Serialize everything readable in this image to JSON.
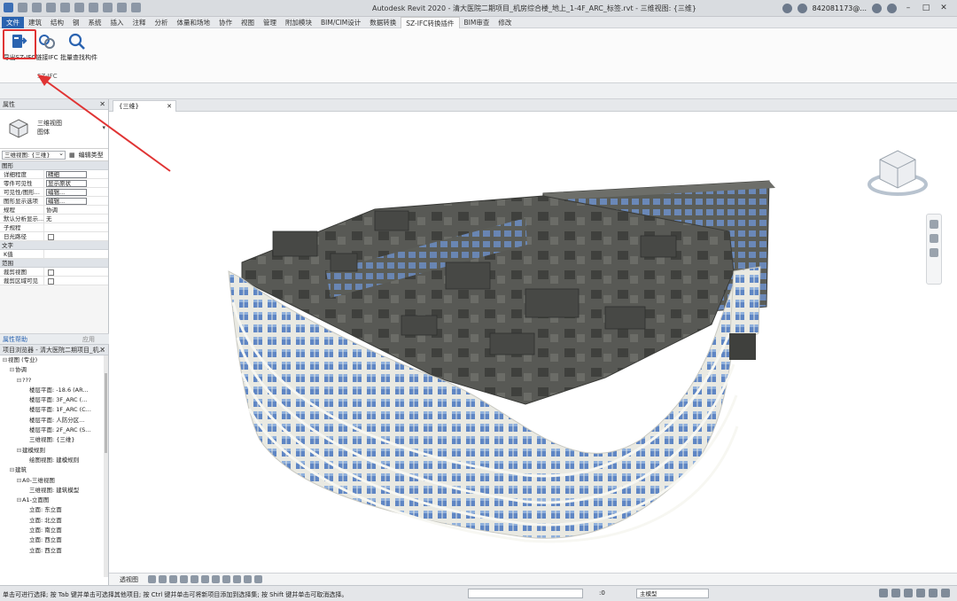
{
  "title_bar": {
    "title": "Autodesk Revit 2020 - 清大医院二期项目_机房综合楼_地上_1-4F_ARC_标签.rvt - 三维视图: {三维}",
    "user": "842081173@...",
    "minimize": "–",
    "maximize": "□",
    "close": "✕"
  },
  "ribbon_tabs": [
    {
      "label": "文件"
    },
    {
      "label": "建筑"
    },
    {
      "label": "结构"
    },
    {
      "label": "钢"
    },
    {
      "label": "系统"
    },
    {
      "label": "插入"
    },
    {
      "label": "注释"
    },
    {
      "label": "分析"
    },
    {
      "label": "体量和场地"
    },
    {
      "label": "协作"
    },
    {
      "label": "视图"
    },
    {
      "label": "管理"
    },
    {
      "label": "附加模块"
    },
    {
      "label": "BIM/CIM设计"
    },
    {
      "label": "数据转换"
    },
    {
      "label": "SZ-IFC转换插件"
    },
    {
      "label": "BIM审查"
    },
    {
      "label": "修改"
    }
  ],
  "ribbon": {
    "buttons": [
      {
        "label": "导出SZ-IFC"
      },
      {
        "label": "链接IFC"
      },
      {
        "label": "批量查找构件"
      }
    ],
    "panel_label": "SZ-IFC"
  },
  "properties": {
    "title": "属性",
    "close": "✕",
    "type_name_1": "三维视图",
    "type_name_2": "图体",
    "filter_value": "三维视图: {三维}",
    "edit_type": "编辑类型",
    "groups": [
      {
        "name": "图形",
        "rows": [
          {
            "k": "详细程度",
            "v": "精细",
            "kind": "box"
          },
          {
            "k": "零件可见性",
            "v": "显示原状",
            "kind": "box"
          },
          {
            "k": "可见性/图形...",
            "v": "编辑...",
            "kind": "btn"
          },
          {
            "k": "图形显示选项",
            "v": "编辑...",
            "kind": "btn"
          },
          {
            "k": "规程",
            "v": "协调",
            "kind": "text"
          },
          {
            "k": "默认分析显示...",
            "v": "无",
            "kind": "text"
          },
          {
            "k": "子规程",
            "v": "",
            "kind": "text"
          },
          {
            "k": "日光路径",
            "v": "",
            "kind": "chk"
          }
        ]
      },
      {
        "name": "文字",
        "rows": [
          {
            "k": "K值",
            "v": "",
            "kind": "text"
          }
        ]
      },
      {
        "name": "范围",
        "rows": [
          {
            "k": "裁剪视图",
            "v": "",
            "kind": "chk"
          },
          {
            "k": "裁剪区域可见",
            "v": "",
            "kind": "chk"
          }
        ]
      }
    ],
    "help_link": "属性帮助",
    "apply": "应用"
  },
  "project_browser": {
    "title": "项目浏览器 - 清大医院二期项目_机...",
    "close": "✕",
    "nodes": [
      {
        "indent": 0,
        "toggle": "⊟",
        "label": "视图 (专业)"
      },
      {
        "indent": 1,
        "toggle": "⊟",
        "label": "协调"
      },
      {
        "indent": 2,
        "toggle": "⊟",
        "label": "???"
      },
      {
        "indent": 3,
        "toggle": "",
        "label": "楼层平面: -18.6 (AR..."
      },
      {
        "indent": 3,
        "toggle": "",
        "label": "楼层平面: 3F_ARC (..."
      },
      {
        "indent": 3,
        "toggle": "",
        "label": "楼层平面: 1F_ARC (C..."
      },
      {
        "indent": 3,
        "toggle": "",
        "label": "楼层平面: 人防分区..."
      },
      {
        "indent": 3,
        "toggle": "",
        "label": "楼层平面: 2F_ARC (S..."
      },
      {
        "indent": 3,
        "toggle": "",
        "label": "三维视图: {三维}"
      },
      {
        "indent": 2,
        "toggle": "⊟",
        "label": "建模规则"
      },
      {
        "indent": 3,
        "toggle": "",
        "label": "绘图视图: 建模规则"
      },
      {
        "indent": 1,
        "toggle": "⊟",
        "label": "建筑"
      },
      {
        "indent": 2,
        "toggle": "⊟",
        "label": "A0-三维视图"
      },
      {
        "indent": 3,
        "toggle": "",
        "label": "三维视图: 建筑模型"
      },
      {
        "indent": 2,
        "toggle": "⊟",
        "label": "A1-立面图"
      },
      {
        "indent": 3,
        "toggle": "",
        "label": "立面: 东立面"
      },
      {
        "indent": 3,
        "toggle": "",
        "label": "立面: 北立面"
      },
      {
        "indent": 3,
        "toggle": "",
        "label": "立面: 南立面"
      },
      {
        "indent": 3,
        "toggle": "",
        "label": "立面: 西立面"
      },
      {
        "indent": 3,
        "toggle": "",
        "label": "立面: 西立面"
      }
    ]
  },
  "view": {
    "tab_label": "{三维}",
    "tab_close": "✕",
    "scale_label": "透视图"
  },
  "status_bar": {
    "message": "单击可进行选择; 按 Tab 键并单击可选择其他项目; 按 Ctrl 键并单击可将新项目添加到选择集; 按 Shift 键并单击可取消选择。",
    "zoom": ":0",
    "model": "主模型"
  },
  "colors": {
    "accent": "#2a63b0",
    "highlight": "#e03434",
    "building_roof": "#4d4e4a",
    "building_facade": "#ecece6",
    "glass": "#5f86c4"
  }
}
